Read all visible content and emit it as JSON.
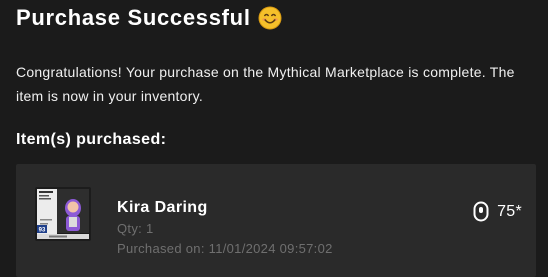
{
  "header": {
    "title": "Purchase Successful",
    "title_icon": "smiling-face-emoji"
  },
  "message": "Congratulations! Your purchase on the Mythical Marketplace is complete. The item is now in your inventory.",
  "items_heading": "Item(s) purchased:",
  "items": [
    {
      "name": "Kira Daring",
      "quantity": "Qty: 1",
      "purchased_on": "Purchased on: 11/01/2024 09:57:02",
      "price": "75*",
      "currency_icon": "coin-icon",
      "thumbnail_icon": "player-card-thumbnail",
      "thumbnail_rating": "93"
    }
  ],
  "colors": {
    "background": "#1b1b1b",
    "card_background": "#2a2a2a",
    "muted_text": "#6f6f6f",
    "emoji_yellow": "#f5c02a"
  }
}
